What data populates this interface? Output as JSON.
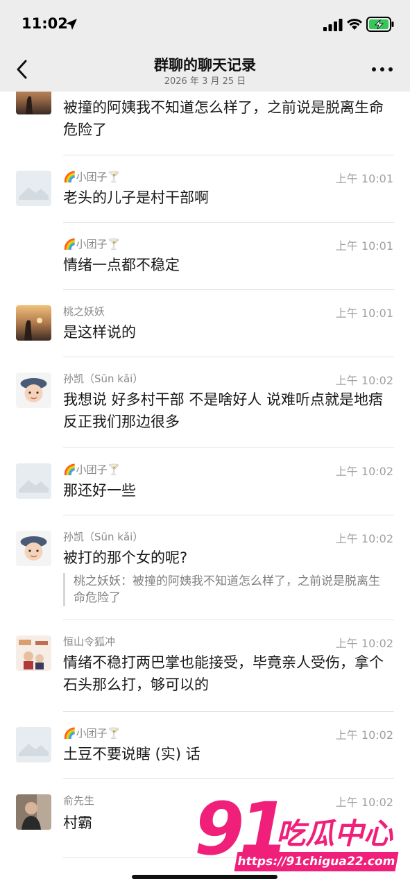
{
  "status_bar": {
    "time": "11:02"
  },
  "nav": {
    "title": "群聊的聊天记录",
    "subtitle": "2026 年 3 月 25 日"
  },
  "messages": [
    {
      "sender": "",
      "time": "",
      "text": "被撞的阿姨我不知道怎么样了，之前说是脱离生命危险了",
      "avatar": "sunset-avatar"
    },
    {
      "sender": "🌈小团子🍸",
      "time": "上午 10:01",
      "text": "老头的儿子是村干部啊",
      "avatar": "placeholder-avatar"
    },
    {
      "sender": "🌈小团子🍸",
      "time": "上午 10:01",
      "text": "情绪一点都不稳定",
      "avatar": ""
    },
    {
      "sender": "桃之妖妖",
      "time": "上午 10:01",
      "text": "是这样说的",
      "avatar": "sunset-avatar"
    },
    {
      "sender": "孙凯（Sūn kǎi）",
      "time": "上午 10:02",
      "text": "我想说  好多村干部  不是啥好人      说难听点就是地痞   反正我们那边很多",
      "avatar": "child-avatar"
    },
    {
      "sender": "🌈小团子🍸",
      "time": "上午 10:02",
      "text": "那还好一些",
      "avatar": "placeholder-avatar"
    },
    {
      "sender": "孙凯（Sūn kǎi）",
      "time": "上午 10:02",
      "text": "被打的那个女的呢?",
      "avatar": "child-avatar",
      "quote": "桃之妖妖：被撞的阿姨我不知道怎么样了，之前说是脱离生命危险了"
    },
    {
      "sender": "恒山令狐冲",
      "time": "上午 10:02",
      "text": "情绪不稳打两巴掌也能接受，毕竟亲人受伤，拿个石头那么打，够可以的",
      "avatar": "poster-avatar"
    },
    {
      "sender": "🌈小团子🍸",
      "time": "上午 10:02",
      "text": "土豆不要说瞎 (实) 话",
      "avatar": "placeholder-avatar"
    },
    {
      "sender": "俞先生",
      "time": "上午 10:02",
      "text": "村霸",
      "avatar": "man-avatar"
    }
  ],
  "watermark": {
    "number": "91",
    "brand": "吃瓜中心",
    "url": "https://91chigua22.com"
  },
  "colors": {
    "header_bg": "#ededed",
    "watermark": "#f0207a",
    "divider": "#e2e2e2"
  }
}
